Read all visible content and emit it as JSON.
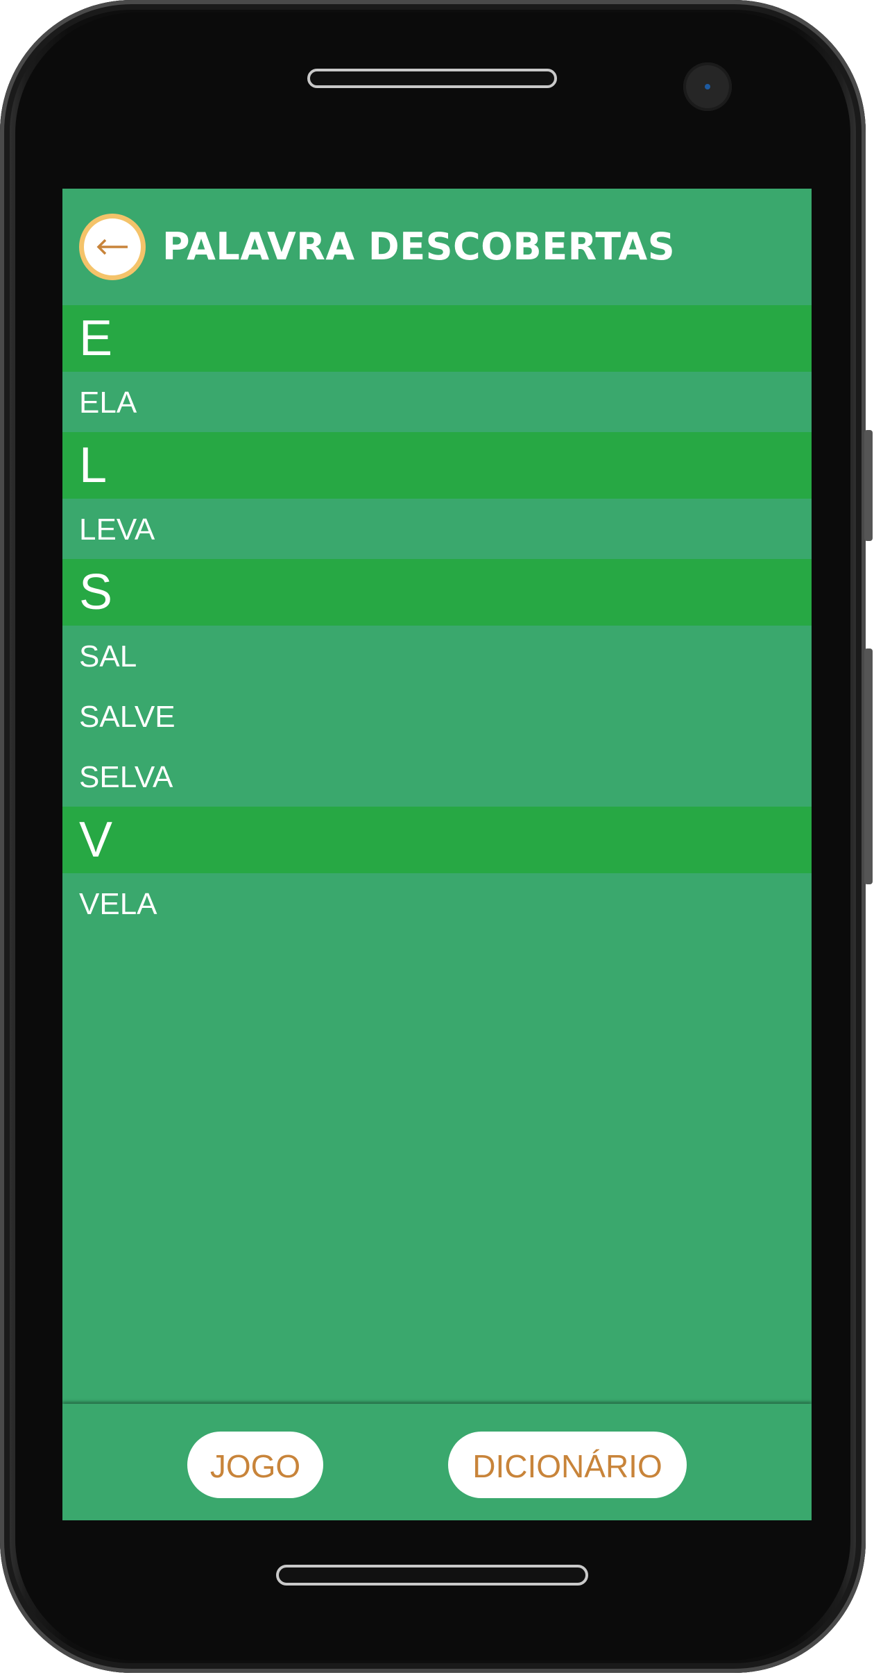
{
  "header": {
    "title": "PALAVRA DESCOBERTAS",
    "back_icon": "arrow-left-icon"
  },
  "groups": [
    {
      "letter": "E",
      "words": [
        "ELA"
      ]
    },
    {
      "letter": "L",
      "words": [
        "LEVA"
      ]
    },
    {
      "letter": "S",
      "words": [
        "SAL",
        "SALVE",
        "SELVA"
      ]
    },
    {
      "letter": "V",
      "words": [
        "VELA"
      ]
    }
  ],
  "footer": {
    "game_label": "JOGO",
    "dictionary_label": "DICIONÁRIO"
  },
  "colors": {
    "background": "#3aa86d",
    "section_header": "#27a844",
    "accent_text": "#c8843a",
    "back_ring": "#f4c36a"
  }
}
